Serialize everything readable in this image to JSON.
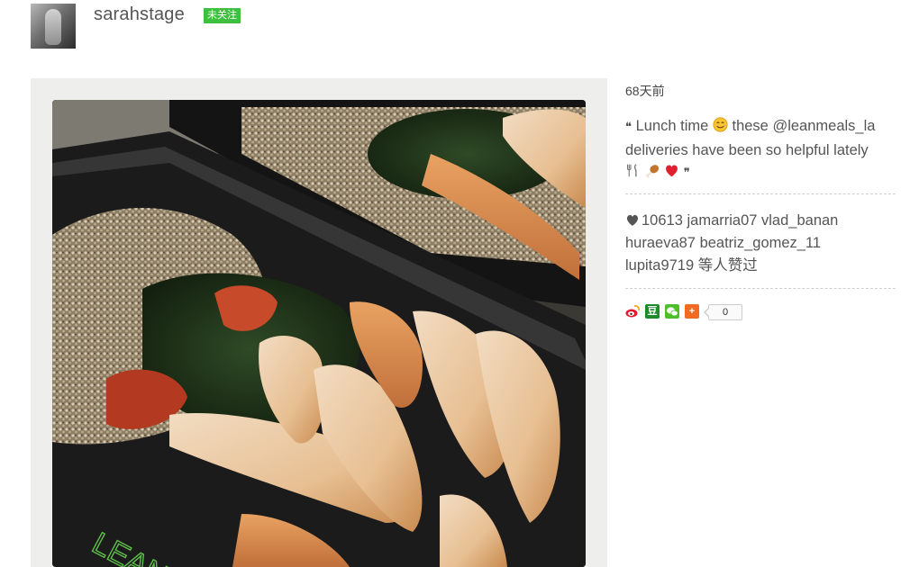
{
  "header": {
    "username": "sarahstage",
    "follow_badge": "未关注"
  },
  "post": {
    "time": "68天前",
    "caption_open_quote": "❝",
    "caption_line1": "Lunch time",
    "caption_line1b": "these @leanmeals_la",
    "caption_line2": "deliveries have been so helpful lately",
    "caption_close_quote": "❞",
    "caption_emojis": [
      "smiling-face-emoji",
      "fork-and-knife-emoji",
      "poultry-leg-emoji",
      "red-heart-emoji"
    ],
    "image_watermark": "LEAN"
  },
  "likes": {
    "count": "10613",
    "line1_users": "jamarria07 vlad_banan",
    "line2_users": "huraeva87 beatriz_gomez_11",
    "line3_users": "lupita9719",
    "suffix": "等人赞过"
  },
  "share": {
    "icons": [
      "weibo-icon",
      "douban-icon",
      "wechat-icon",
      "more-share-icon"
    ],
    "douban_glyph": "豆",
    "more_glyph": "+",
    "count": "0"
  },
  "colors": {
    "follow_badge": "#3fbf3f",
    "text": "#555555",
    "divider": "#cfcfcf"
  }
}
